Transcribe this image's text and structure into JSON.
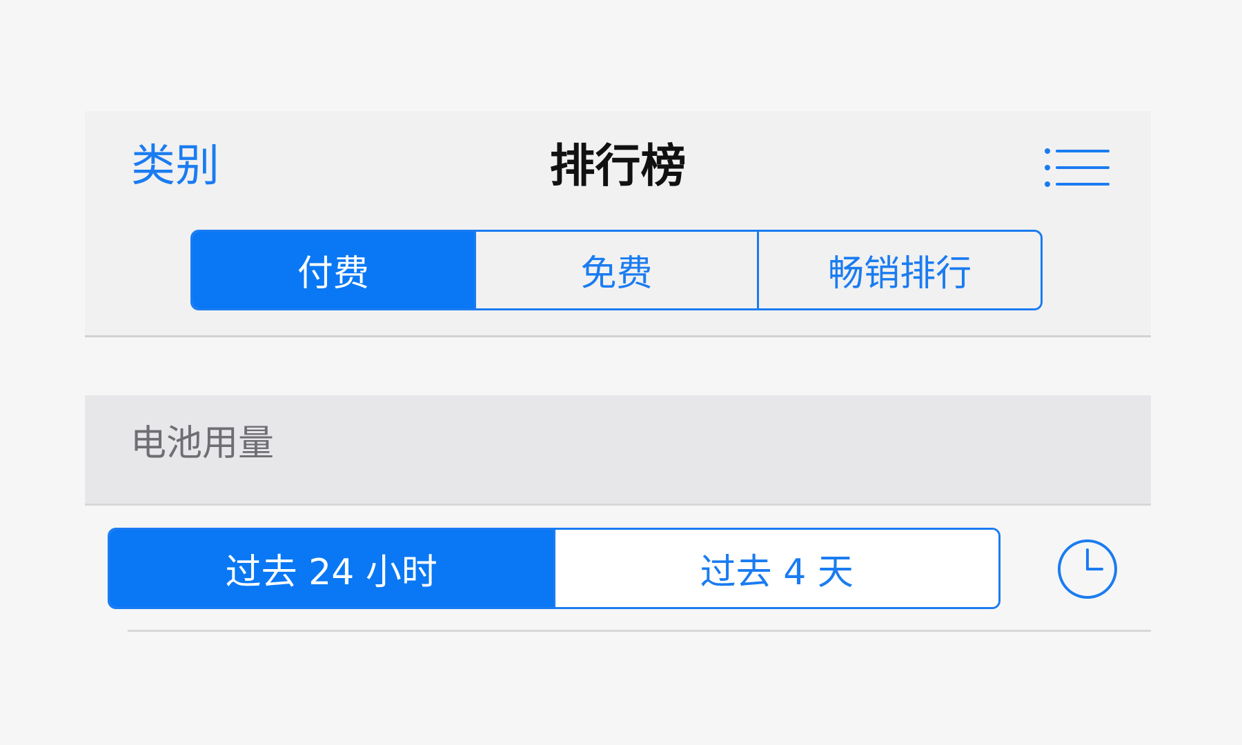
{
  "nav": {
    "back_label": "类别",
    "title": "排行榜",
    "list_icon": "list-icon"
  },
  "chart_tabs": [
    {
      "label": "付费",
      "selected": true
    },
    {
      "label": "免费",
      "selected": false
    },
    {
      "label": "畅销排行",
      "selected": false
    }
  ],
  "section": {
    "title": "电池用量"
  },
  "time_range_tabs": [
    {
      "label": "过去 24 小时",
      "selected": true
    },
    {
      "label": "过去 4 天",
      "selected": false
    }
  ],
  "clock_icon": "clock-icon",
  "colors": {
    "accent": "#1a7cf0",
    "selected_fill": "#0a78f5",
    "background": "#f6f6f6",
    "nav_background": "#f1f1f1",
    "section_background": "#e7e7ea",
    "section_text": "#6e6e73"
  }
}
